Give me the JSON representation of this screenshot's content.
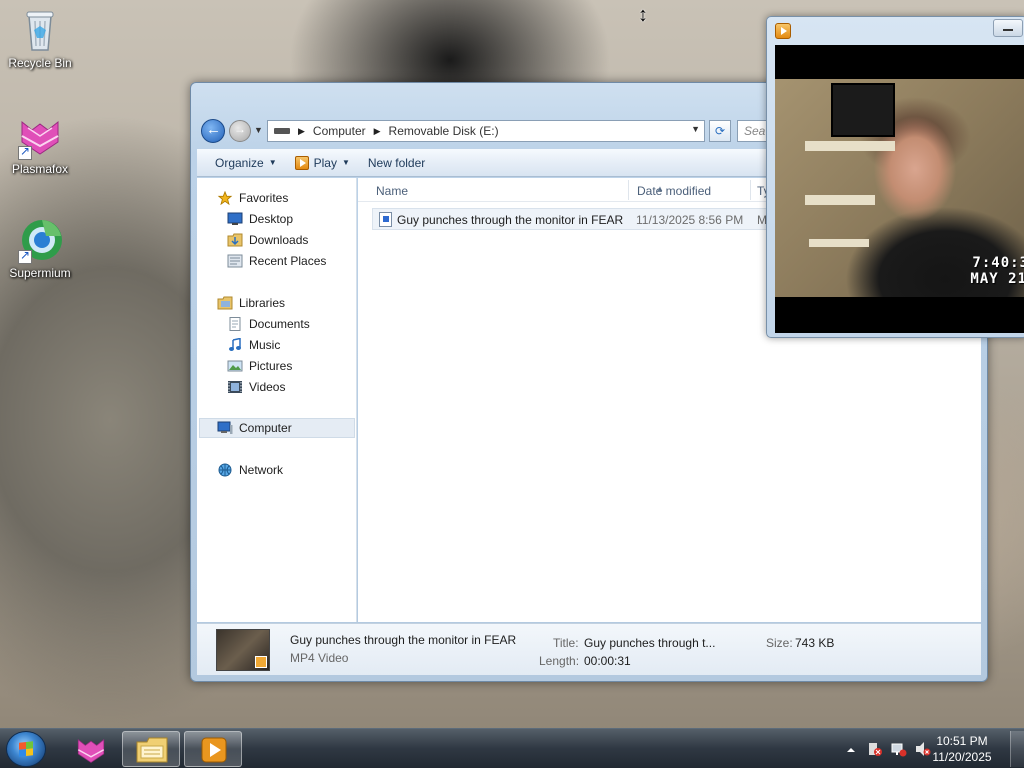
{
  "desktop": {
    "icons": [
      {
        "label": "Recycle Bin"
      },
      {
        "label": "Plasmafox"
      },
      {
        "label": "Supermium"
      }
    ]
  },
  "explorer": {
    "address": {
      "segments": [
        "Computer",
        "Removable Disk (E:)"
      ],
      "search_placeholder": "Sea"
    },
    "toolbar": {
      "organize": "Organize",
      "play": "Play",
      "new_folder": "New folder"
    },
    "nav": {
      "favorites": "Favorites",
      "desktop": "Desktop",
      "downloads": "Downloads",
      "recent_places": "Recent Places",
      "libraries": "Libraries",
      "documents": "Documents",
      "music": "Music",
      "pictures": "Pictures",
      "videos": "Videos",
      "computer": "Computer",
      "network": "Network"
    },
    "columns": {
      "name": "Name",
      "date_modified": "Date modified",
      "type": "Ty"
    },
    "files": [
      {
        "name": "Guy punches through the monitor in FEAR",
        "date": "11/13/2025 8:56 PM",
        "type": "M"
      }
    ],
    "details": {
      "title": "Guy punches through the monitor in FEAR",
      "kind": "MP4 Video",
      "title_label": "Title:",
      "title_value": "Guy punches through t...",
      "length_label": "Length:",
      "length_value": "00:00:31",
      "size_label": "Size:",
      "size_value": "743 KB"
    }
  },
  "player": {
    "timestamp_time": "7:40:3",
    "timestamp_date": "MAY 21"
  },
  "taskbar": {
    "time": "10:51 PM",
    "date": "11/20/2025"
  }
}
